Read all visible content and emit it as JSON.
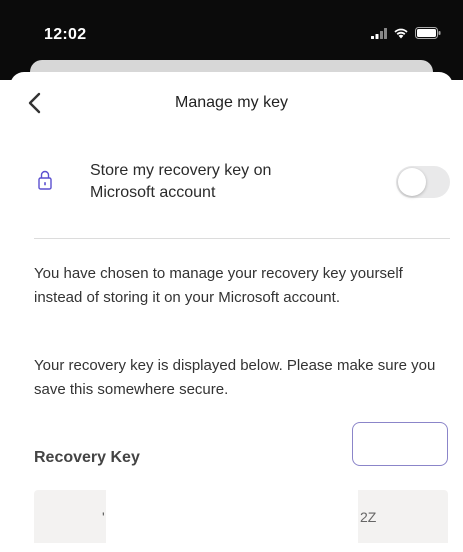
{
  "status_bar": {
    "time": "12:02",
    "icons": [
      "signal-icon",
      "wifi-icon",
      "battery-icon"
    ]
  },
  "header": {
    "title": "Manage my key",
    "back_icon": "chevron-left-icon"
  },
  "store_setting": {
    "icon": "lock-icon",
    "label": "Store my recovery key on Microsoft account",
    "toggle_on": false
  },
  "info": {
    "paragraph1": "You have chosen to manage your recovery key yourself instead of storing it on your Microsoft account.",
    "paragraph2": "Your recovery key is displayed below. Please make sure you save this somewhere secure."
  },
  "recovery_key": {
    "label": "Recovery Key",
    "value_start": "'",
    "value_end": "2Z"
  },
  "colors": {
    "accent": "#8b85c9",
    "lock_icon": "#5b4fcf",
    "status_bar": "#0b0b0b",
    "key_background": "#f3f2f1"
  }
}
